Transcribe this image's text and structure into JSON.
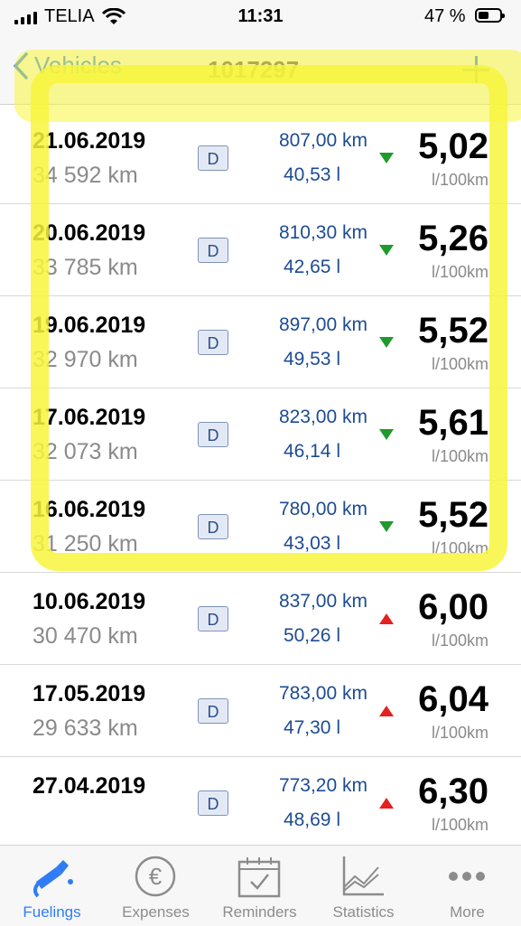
{
  "status_bar": {
    "carrier": "TELIA",
    "time": "11:31",
    "battery": "47 %"
  },
  "nav": {
    "back_label": "Vehicles",
    "title": "1017297"
  },
  "rows": [
    {
      "date": "21.06.2019",
      "odometer": "34 592 km",
      "fuel_badge": "D",
      "distance": "807,00 km",
      "volume": "40,53 l",
      "trend": "down",
      "consumption": "5,02",
      "unit": "l/100km"
    },
    {
      "date": "20.06.2019",
      "odometer": "33 785 km",
      "fuel_badge": "D",
      "distance": "810,30 km",
      "volume": "42,65 l",
      "trend": "down",
      "consumption": "5,26",
      "unit": "l/100km"
    },
    {
      "date": "19.06.2019",
      "odometer": "32 970 km",
      "fuel_badge": "D",
      "distance": "897,00 km",
      "volume": "49,53 l",
      "trend": "down",
      "consumption": "5,52",
      "unit": "l/100km"
    },
    {
      "date": "17.06.2019",
      "odometer": "32 073 km",
      "fuel_badge": "D",
      "distance": "823,00 km",
      "volume": "46,14 l",
      "trend": "down",
      "consumption": "5,61",
      "unit": "l/100km"
    },
    {
      "date": "16.06.2019",
      "odometer": "31 250 km",
      "fuel_badge": "D",
      "distance": "780,00 km",
      "volume": "43,03 l",
      "trend": "down",
      "consumption": "5,52",
      "unit": "l/100km"
    },
    {
      "date": "10.06.2019",
      "odometer": "30 470 km",
      "fuel_badge": "D",
      "distance": "837,00 km",
      "volume": "50,26 l",
      "trend": "up",
      "consumption": "6,00",
      "unit": "l/100km"
    },
    {
      "date": "17.05.2019",
      "odometer": "29 633 km",
      "fuel_badge": "D",
      "distance": "783,00 km",
      "volume": "47,30 l",
      "trend": "up",
      "consumption": "6,04",
      "unit": "l/100km"
    },
    {
      "date": "27.04.2019",
      "odometer": "",
      "fuel_badge": "D",
      "distance": "773,20 km",
      "volume": "48,69 l",
      "trend": "up",
      "consumption": "6,30",
      "unit": "l/100km"
    }
  ],
  "tabs": [
    {
      "label": "Fuelings",
      "icon": "fuel-pump-icon",
      "active": true
    },
    {
      "label": "Expenses",
      "icon": "euro-icon",
      "active": false
    },
    {
      "label": "Reminders",
      "icon": "calendar-check-icon",
      "active": false
    },
    {
      "label": "Statistics",
      "icon": "line-chart-icon",
      "active": false
    },
    {
      "label": "More",
      "icon": "more-dots-icon",
      "active": false
    }
  ],
  "colors": {
    "accent": "#2f7cf6",
    "down": "#1f9a2c",
    "up": "#e52020",
    "highlight": "#f7f53c"
  }
}
